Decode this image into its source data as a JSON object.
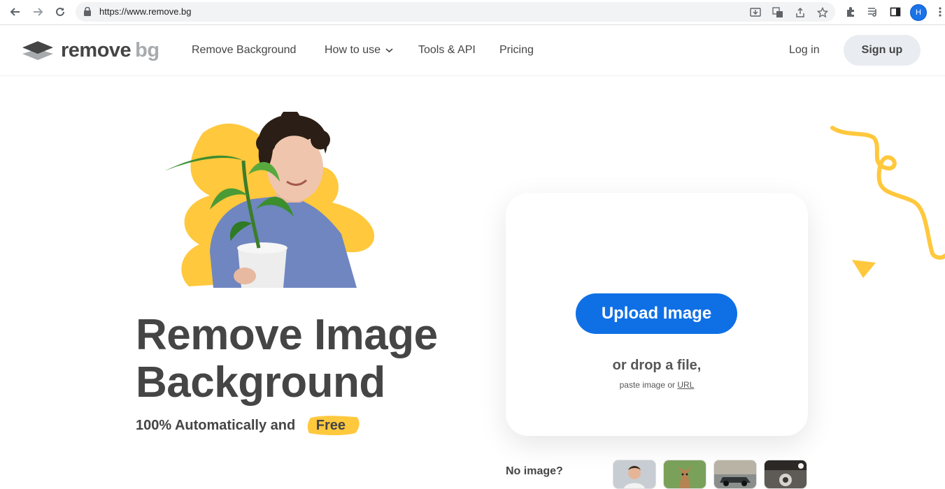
{
  "browser": {
    "url": "https://www.remove.bg",
    "profile_initial": "H"
  },
  "header": {
    "logo_word_1": "remove",
    "logo_word_2": "bg",
    "nav": [
      "Remove Background",
      "How to use",
      "Tools & API",
      "Pricing"
    ],
    "login": "Log in",
    "signup": "Sign up"
  },
  "hero": {
    "title_line_1": "Remove Image",
    "title_line_2": "Background",
    "subtitle": "100% Automatically and",
    "subtitle_highlight": "Free"
  },
  "upload": {
    "button": "Upload Image",
    "drop_text": "or drop a file,",
    "paste_text": "paste image or",
    "paste_link": "URL"
  },
  "samples": {
    "label": "No image?"
  },
  "colors": {
    "accent_blue": "#0f70e6",
    "brand_yellow": "#ffc83d",
    "text_dark": "#454545"
  }
}
